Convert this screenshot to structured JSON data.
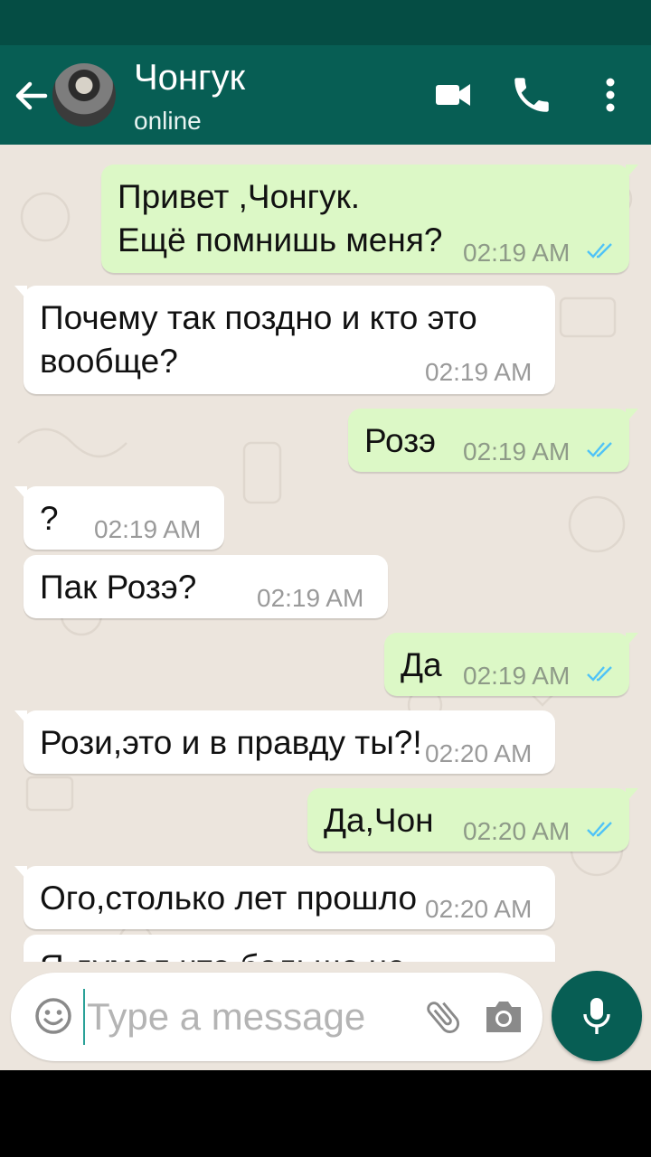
{
  "header": {
    "contact_name": "Чонгук",
    "status": "online",
    "icons": [
      "back-arrow-icon",
      "video-call-icon",
      "phone-icon",
      "more-vertical-icon"
    ]
  },
  "messages": [
    {
      "direction": "out",
      "text_lines": [
        "Привет ,Чонгук.",
        "Ещё помнишь меня?"
      ],
      "time": "02:19 AM",
      "read": true
    },
    {
      "direction": "in",
      "text_lines": [
        "Почему так поздно и кто это",
        "вообще?"
      ],
      "time": "02:19 AM"
    },
    {
      "direction": "out",
      "text_lines": [
        "Розэ"
      ],
      "time": "02:19 AM",
      "read": true
    },
    {
      "direction": "in",
      "text_lines": [
        "?"
      ],
      "time": "02:19 AM"
    },
    {
      "direction": "in",
      "text_lines": [
        "Пак Розэ?"
      ],
      "time": "02:19 AM"
    },
    {
      "direction": "out",
      "text_lines": [
        "Да"
      ],
      "time": "02:19 AM",
      "read": true
    },
    {
      "direction": "in",
      "text_lines": [
        "Рози,это и в правду ты?!"
      ],
      "time": "02:20 AM"
    },
    {
      "direction": "out",
      "text_lines": [
        "Да,Чон"
      ],
      "time": "02:20 AM",
      "read": true
    },
    {
      "direction": "in",
      "text_lines": [
        "Ого,столько лет прошло"
      ],
      "time": "02:20 AM"
    },
    {
      "direction": "in",
      "text_lines": [
        "Я думал что больше не"
      ],
      "time": ""
    }
  ],
  "composer": {
    "placeholder": "Type a message",
    "value": ""
  },
  "colors": {
    "header": "#075e54",
    "status_bar": "#054d44",
    "outgoing_bubble": "#dcf8c6",
    "incoming_bubble": "#ffffff",
    "chat_background": "#ece5dd",
    "read_ticks": "#4fc3f7"
  }
}
